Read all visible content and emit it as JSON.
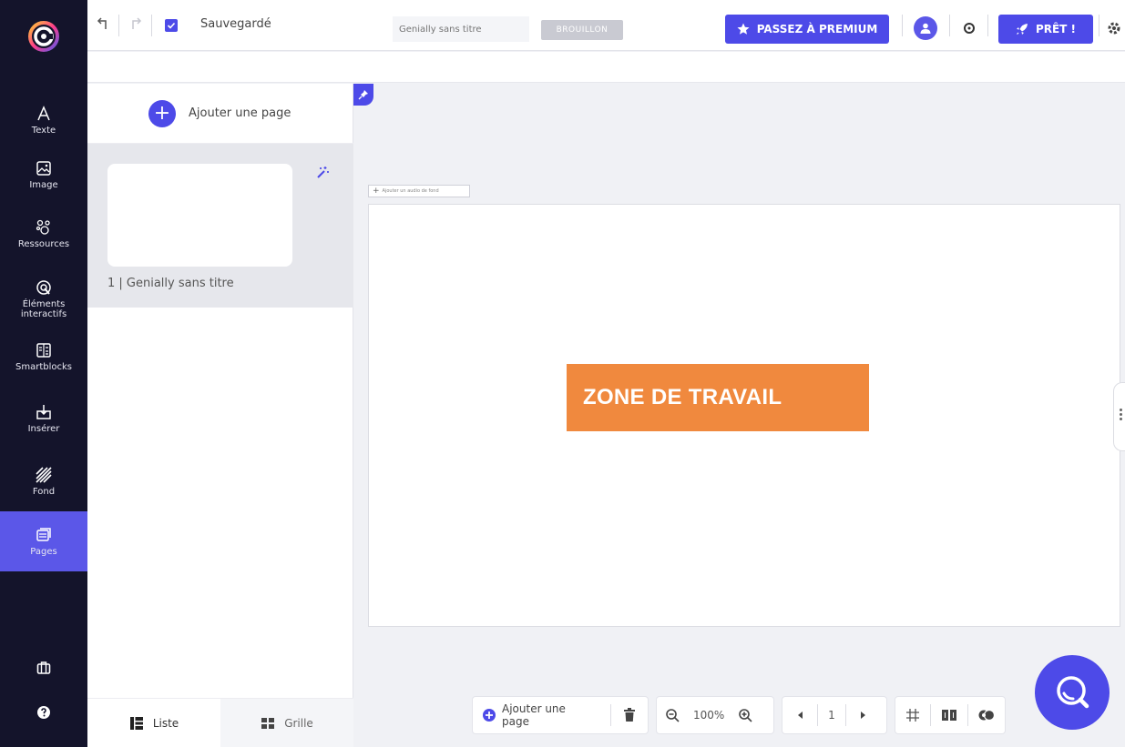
{
  "rail": {
    "items": [
      {
        "label": "Texte",
        "icon": "text-icon"
      },
      {
        "label": "Image",
        "icon": "image-icon"
      },
      {
        "label": "Ressources",
        "icon": "resources-icon"
      },
      {
        "label": "Éléments interactifs",
        "icon": "interactive-icon"
      },
      {
        "label": "Smartblocks",
        "icon": "smartblocks-icon"
      },
      {
        "label": "Insérer",
        "icon": "insert-icon"
      },
      {
        "label": "Fond",
        "icon": "background-icon"
      },
      {
        "label": "Pages",
        "icon": "pages-icon",
        "active": true
      }
    ]
  },
  "topbar": {
    "save_status": "Sauvegardé",
    "title_placeholder": "Genially sans titre",
    "draft_badge": "BROUILLON",
    "premium_label": "PASSEZ À PREMIUM",
    "ready_label": "PRÊT !"
  },
  "panel": {
    "add_page_label": "Ajouter une page",
    "page_label": "1 | Genially sans titre",
    "list_label": "Liste",
    "grid_label": "Grille"
  },
  "workspace": {
    "audio_label": "Ajouter un audio de fond",
    "zone_label": "ZONE DE TRAVAIL"
  },
  "bottom_toolbar": {
    "add_page_line1": "Ajouter une",
    "add_page_line2": "page",
    "zoom": "100%",
    "page_number": "1"
  },
  "colors": {
    "rail_bg": "#14142b",
    "accent": "#4d4ae8",
    "zone_orange": "#f0893e"
  }
}
